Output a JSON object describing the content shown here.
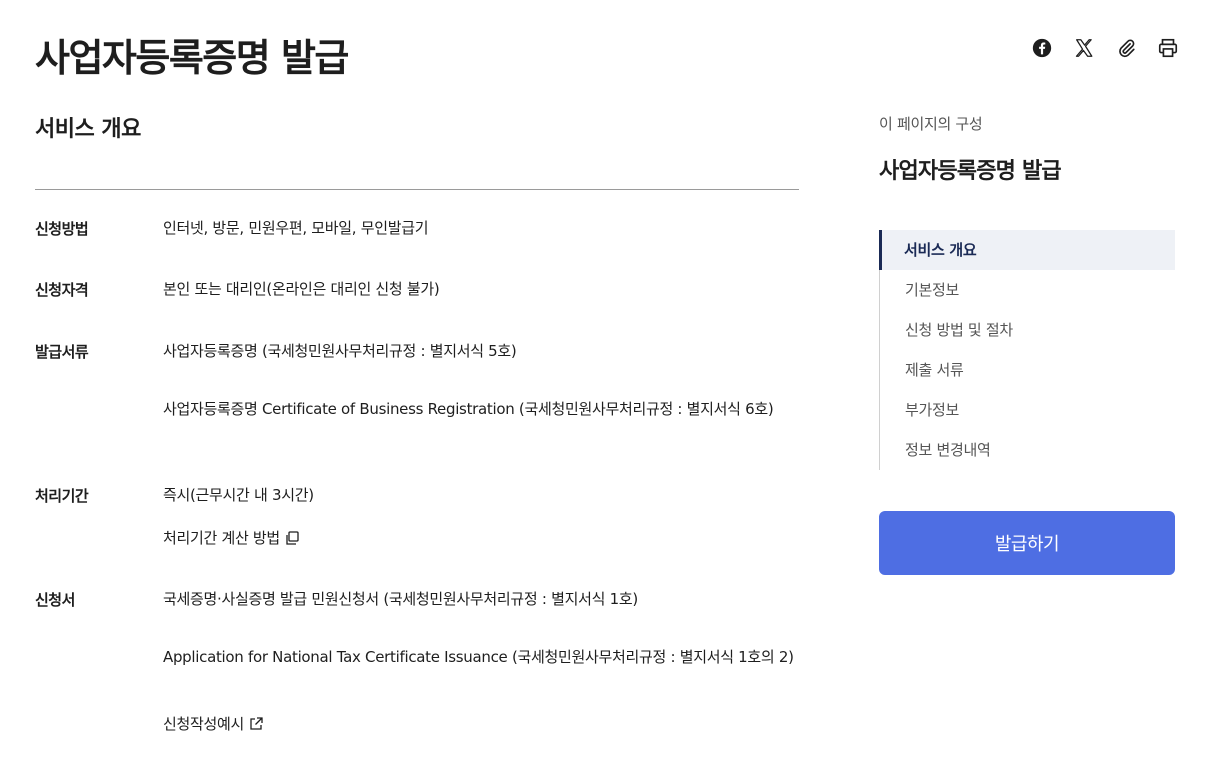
{
  "page": {
    "title": "사업자등록증명 발급"
  },
  "share": {
    "icons": [
      "facebook-icon",
      "x-icon",
      "paperclip-icon",
      "print-icon"
    ]
  },
  "overview": {
    "title": "서비스 개요",
    "rows": [
      {
        "label": "신청방법",
        "values": [
          "인터넷, 방문, 민원우편, 모바일, 무인발급기"
        ]
      },
      {
        "label": "신청자격",
        "values": [
          "본인 또는 대리인(온라인은 대리인 신청 불가)"
        ]
      },
      {
        "label": "발급서류",
        "values": [
          "사업자등록증명 (국세청민원사무처리규정 : 별지서식 5호)",
          "사업자등록증명 Certificate of Business Registration (국세청민원사무처리규정 : 별지서식 6호)"
        ]
      },
      {
        "label": "처리기간",
        "values": [
          "즉시(근무시간 내 3시간)"
        ],
        "link": "처리기간 계산 방법"
      },
      {
        "label": "신청서",
        "values": [
          "국세증명·사실증명 발급 민원신청서 (국세청민원사무처리규정 : 별지서식 1호)",
          "Application for National Tax Certificate Issuance (국세청민원사무처리규정 : 별지서식 1호의 2)"
        ],
        "link": "신청작성예시"
      }
    ]
  },
  "toc": {
    "caption": "이 페이지의 구성",
    "title": "사업자등록증명 발급",
    "items": [
      "서비스 개요",
      "기본정보",
      "신청 방법 및 절차",
      "제출 서류",
      "부가정보",
      "정보 변경내역"
    ],
    "active_index": 0
  },
  "action": {
    "issue_label": "발급하기",
    "color": "#4e6ee3"
  }
}
